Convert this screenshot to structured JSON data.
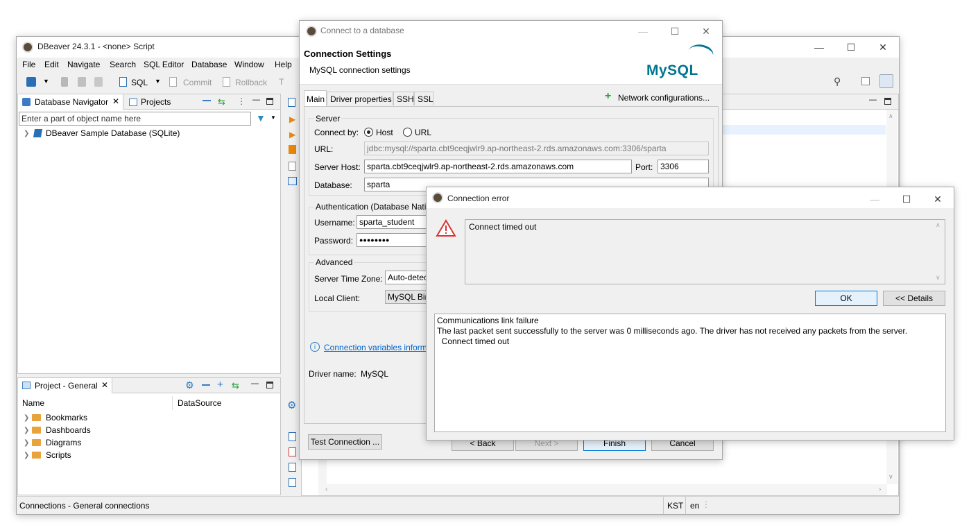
{
  "main_window": {
    "title": "DBeaver 24.3.1 - <none> Script",
    "menu": [
      "File",
      "Edit",
      "Navigate",
      "Search",
      "SQL Editor",
      "Database",
      "Window",
      "Help"
    ],
    "toolbar": {
      "sql_label": "SQL",
      "commit_label": "Commit",
      "rollback_label": "Rollback"
    },
    "navigator": {
      "tab_db": "Database Navigator",
      "tab_projects": "Projects",
      "filter_placeholder": "Enter a part of object name here",
      "tree": [
        "DBeaver Sample Database (SQLite)"
      ]
    },
    "project": {
      "tab": "Project - General",
      "col_name": "Name",
      "col_datasource": "DataSource",
      "items": [
        "Bookmarks",
        "Dashboards",
        "Diagrams",
        "Scripts"
      ]
    },
    "status": {
      "left": "Connections - General connections",
      "tz": "KST",
      "locale": "en"
    }
  },
  "connect_dialog": {
    "title": "Connect to a database",
    "heading": "Connection Settings",
    "subheading": "MySQL connection settings",
    "logo_text": "MySQL",
    "tabs": [
      "Main",
      "Driver properties",
      "SSH",
      "SSL"
    ],
    "network_config": "Network configurations...",
    "server_group": "Server",
    "connect_by_label": "Connect by:",
    "opt_host": "Host",
    "opt_url": "URL",
    "url_label": "URL:",
    "url_value": "jdbc:mysql://sparta.cbt9ceqjwlr9.ap-northeast-2.rds.amazonaws.com:3306/sparta",
    "host_label": "Server Host:",
    "host_value": "sparta.cbt9ceqjwlr9.ap-northeast-2.rds.amazonaws.com",
    "port_label": "Port:",
    "port_value": "3306",
    "db_label": "Database:",
    "db_value": "sparta",
    "auth_group": "Authentication (Database Nativ",
    "user_label": "Username:",
    "user_value": "sparta_student",
    "pass_label": "Password:",
    "pass_value": "●●●●●●●●",
    "advanced_group": "Advanced",
    "tz_label": "Server Time Zone:",
    "tz_value": "Auto-detec",
    "client_label": "Local Client:",
    "client_value": "MySQL Bin",
    "conn_vars_link": "Connection variables inform",
    "driver_label": "Driver name:",
    "driver_value": "MySQL",
    "btn_test": "Test Connection ...",
    "btn_back": "< Back",
    "btn_next": "Next >",
    "btn_finish": "Finish",
    "btn_cancel": "Cancel"
  },
  "error_dialog": {
    "title": "Connection error",
    "message": "Connect timed out",
    "btn_ok": "OK",
    "btn_details": "<< Details",
    "details_lines": [
      "Communications link failure",
      "The last packet sent successfully to the server was 0 milliseconds ago. The driver has not received any packets from the server.",
      "  Connect timed out"
    ]
  },
  "colors": {
    "accent": "#0078d7",
    "link": "#0066cc",
    "mysql_blue": "#00758f",
    "mysql_orange": "#f29111",
    "warning_red": "#d9322e"
  }
}
